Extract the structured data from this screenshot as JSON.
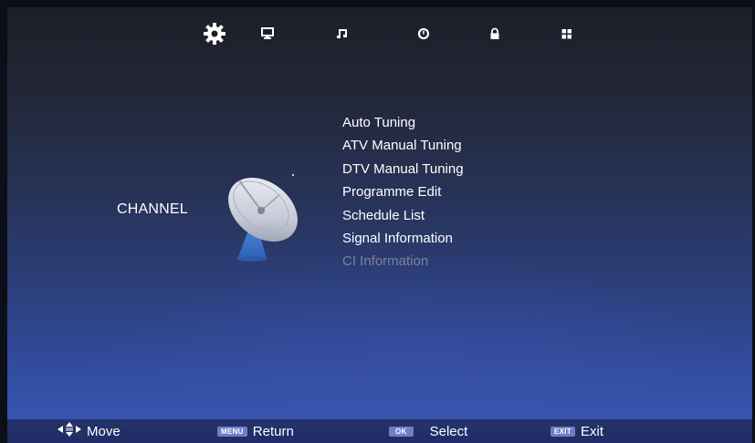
{
  "top_tabs": [
    {
      "icon": "gear-icon",
      "active": true
    },
    {
      "icon": "monitor-icon",
      "active": false
    },
    {
      "icon": "music-note-icon",
      "active": false
    },
    {
      "icon": "clock-icon",
      "active": false
    },
    {
      "icon": "lock-icon",
      "active": false
    },
    {
      "icon": "grid-icon",
      "active": false
    }
  ],
  "section": {
    "title": "CHANNEL",
    "illustration": "satellite-dish-icon"
  },
  "menu": {
    "items": [
      {
        "label": "Auto Tuning",
        "enabled": true
      },
      {
        "label": "ATV Manual Tuning",
        "enabled": true
      },
      {
        "label": "DTV Manual Tuning",
        "enabled": true
      },
      {
        "label": "Programme Edit",
        "enabled": true
      },
      {
        "label": "Schedule List",
        "enabled": true
      },
      {
        "label": "Signal Information",
        "enabled": true
      },
      {
        "label": "CI Information",
        "enabled": false
      }
    ]
  },
  "bottom_bar": {
    "move": {
      "icon": "arrows-icon",
      "label": "Move"
    },
    "return": {
      "key": "MENU",
      "label": "Return"
    },
    "select": {
      "key": "OK",
      "label": "Select"
    },
    "exit": {
      "key": "EXIT",
      "label": "Exit"
    }
  },
  "colors": {
    "text": "#ffffff",
    "disabled_text": "#7d8299",
    "key_badge": "#6d7fc7",
    "bottom_bar": "#23306a"
  }
}
